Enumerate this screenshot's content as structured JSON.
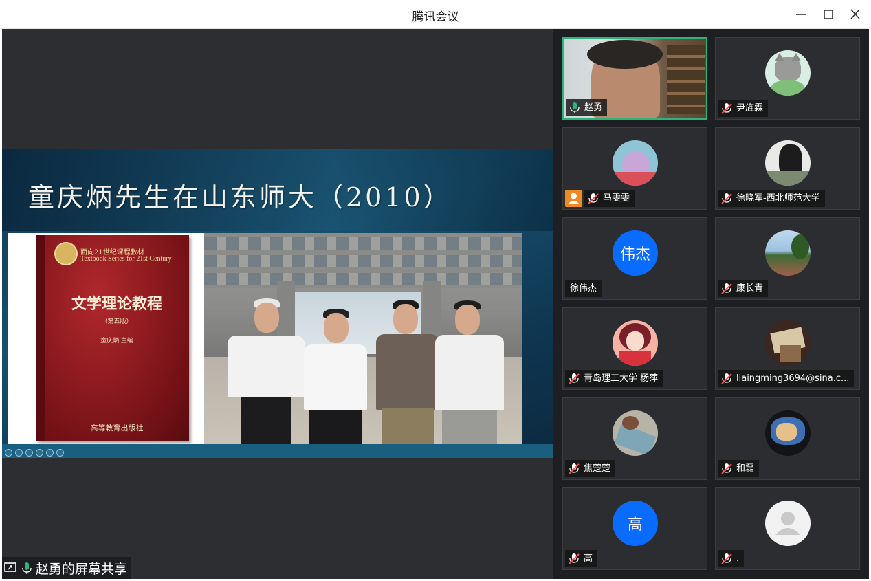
{
  "window": {
    "title": "腾讯会议"
  },
  "share": {
    "label": "赵勇的屏幕共享"
  },
  "slide": {
    "title": "童庆炳先生在山东师大（2010）",
    "book": {
      "series_cn": "面向21世纪课程教材",
      "series_en": "Textbook Series for 21st Century",
      "title": "文学理论教程",
      "edition": "（第五版）",
      "author": "童庆炳  主编",
      "publisher": "高等教育出版社"
    }
  },
  "participants": [
    {
      "name": "赵勇",
      "mic": "on",
      "avatar_type": "video"
    },
    {
      "name": "尹旌霖",
      "mic": "muted",
      "avatar_type": "image"
    },
    {
      "name": "马雯雯",
      "mic": "muted",
      "avatar_type": "image"
    },
    {
      "name": "徐晓军-西北师范大学",
      "mic": "muted",
      "avatar_type": "image"
    },
    {
      "name": "徐伟杰",
      "mic": "none",
      "avatar_type": "text",
      "avatar_text": "伟杰"
    },
    {
      "name": "康长青",
      "mic": "muted",
      "avatar_type": "image"
    },
    {
      "name": "青岛理工大学 杨萍",
      "mic": "muted",
      "avatar_type": "image"
    },
    {
      "name": "liaingming3694@sina.c...",
      "mic": "muted",
      "avatar_type": "image"
    },
    {
      "name": "焦楚楚",
      "mic": "muted",
      "avatar_type": "image"
    },
    {
      "name": "和磊",
      "mic": "muted",
      "avatar_type": "image"
    },
    {
      "name": "高",
      "mic": "muted",
      "avatar_type": "text",
      "avatar_text": "高"
    },
    {
      "name": ".",
      "mic": "muted",
      "avatar_type": "default"
    }
  ],
  "colors": {
    "accent": "#0a6cff",
    "active_border": "#2fb37a",
    "mic_muted": "#ff4d4d",
    "mic_on": "#2fb37a"
  }
}
